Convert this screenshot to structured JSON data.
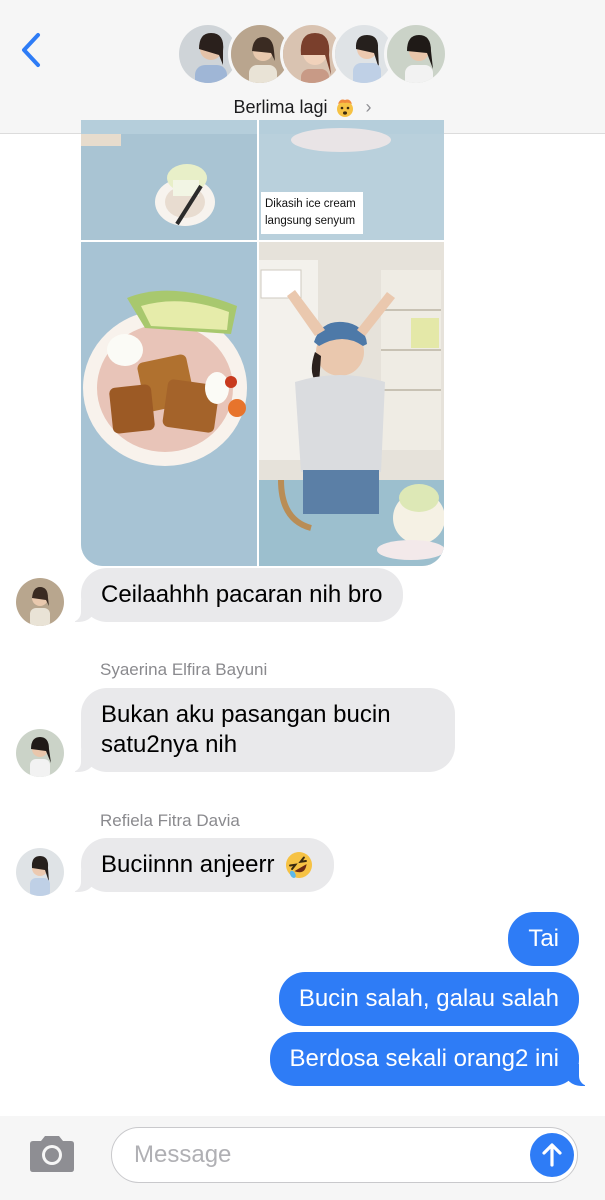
{
  "header": {
    "back_icon": "chevron-left-icon",
    "group_name": "Berlima lagi",
    "group_emoji": "exploding-head-emoji",
    "chevron_icon": "chevron-right-icon",
    "participant_count_avatars": 5
  },
  "collage": {
    "caption": [
      "Dikasih ice cream",
      "langsung senyum"
    ]
  },
  "messages": [
    {
      "direction": "incoming",
      "sender": "",
      "text": "Ceilaahhh pacaran nih bro"
    },
    {
      "direction": "incoming",
      "sender": "Syaerina Elfira Bayuni",
      "text_lines": [
        "Bukan aku pasangan bucin",
        "satu2nya nih"
      ]
    },
    {
      "direction": "incoming",
      "sender": "Refiela Fitra Davia",
      "text": "Buciinnn anjeerr",
      "emoji": "rofl-emoji"
    },
    {
      "direction": "outgoing",
      "text": "Tai"
    },
    {
      "direction": "outgoing",
      "text": "Bucin salah, galau salah"
    },
    {
      "direction": "outgoing",
      "text": "Berdosa sekali orang2 ini"
    }
  ],
  "composer": {
    "placeholder": "Message",
    "camera_icon": "camera-icon",
    "send_icon": "arrow-up-icon"
  },
  "colors": {
    "outgoing_bubble": "#2e7cf6",
    "incoming_bubble": "#e9e9eb",
    "accent": "#2e7cf6"
  }
}
